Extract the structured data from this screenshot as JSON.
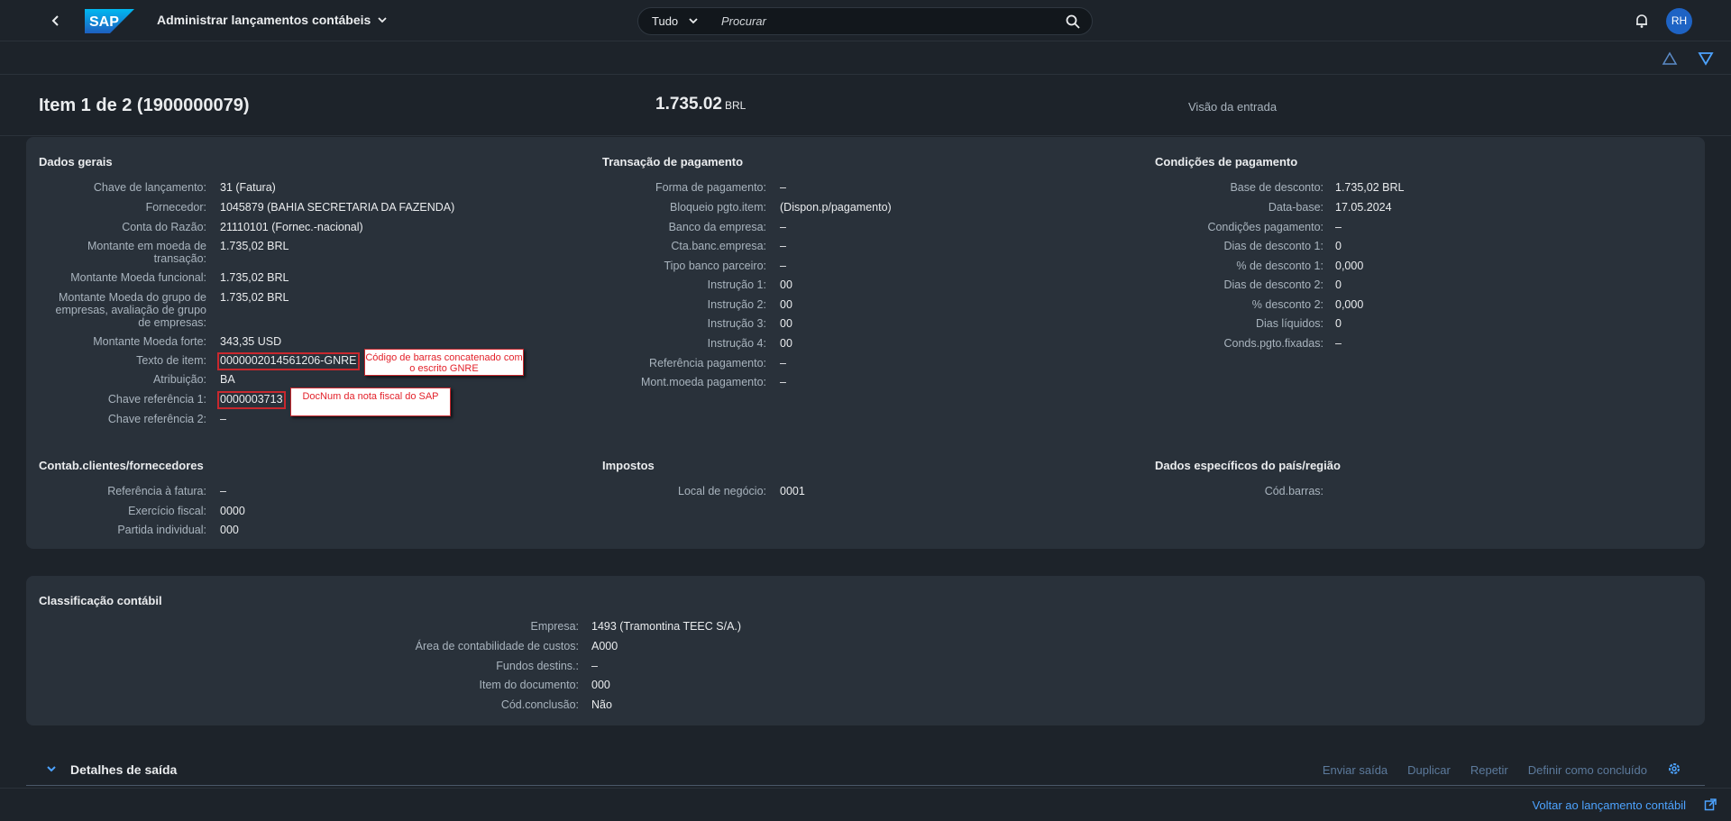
{
  "shell": {
    "logo_text": "SAP",
    "app_title": "Administrar lançamentos contábeis",
    "search_scope": "Tudo",
    "search_placeholder": "Procurar",
    "avatar_initials": "RH"
  },
  "header": {
    "title": "Item 1 de 2 (1900000079)",
    "amount": "1.735.02",
    "currency": "BRL",
    "view_link": "Visão da entrada"
  },
  "dados_gerais": {
    "title": "Dados gerais",
    "rows": [
      {
        "label": "Chave de lançamento:",
        "value": "31 (Fatura)"
      },
      {
        "label": "Fornecedor:",
        "value": "1045879 (BAHIA SECRETARIA DA FAZENDA)"
      },
      {
        "label": "Conta do Razão:",
        "value": "21110101 (Fornec.-nacional)"
      },
      {
        "label": "Montante em moeda de transação:",
        "value": "1.735,02  BRL"
      },
      {
        "label": "Montante Moeda funcional:",
        "value": "1.735,02  BRL"
      },
      {
        "label": "Montante Moeda do grupo de empresas, avaliação de grupo de empresas:",
        "value": "1.735,02  BRL"
      },
      {
        "label": "Montante Moeda forte:",
        "value": "343,35  USD"
      },
      {
        "label": "Texto de item:",
        "value": "0000002014561206-GNRE"
      },
      {
        "label": "Atribuição:",
        "value": "BA"
      },
      {
        "label": "Chave referência 1:",
        "value": "0000003713"
      },
      {
        "label": "Chave referência 2:",
        "value": "–"
      }
    ]
  },
  "transacao_pagamento": {
    "title": "Transação de pagamento",
    "rows": [
      {
        "label": "Forma de pagamento:",
        "value": "–"
      },
      {
        "label": "Bloqueio pgto.item:",
        "value": "(Dispon.p/pagamento)"
      },
      {
        "label": "Banco da empresa:",
        "value": "–"
      },
      {
        "label": "Cta.banc.empresa:",
        "value": "–"
      },
      {
        "label": "Tipo banco parceiro:",
        "value": "–"
      },
      {
        "label": "Instrução 1:",
        "value": "00"
      },
      {
        "label": "Instrução 2:",
        "value": "00"
      },
      {
        "label": "Instrução 3:",
        "value": "00"
      },
      {
        "label": "Instrução 4:",
        "value": "00"
      },
      {
        "label": "Referência pagamento:",
        "value": "–"
      },
      {
        "label": "Mont.moeda pagamento:",
        "value": "–"
      }
    ]
  },
  "condicoes_pagamento": {
    "title": "Condições de pagamento",
    "rows": [
      {
        "label": "Base de desconto:",
        "value": "1.735,02  BRL"
      },
      {
        "label": "Data-base:",
        "value": "17.05.2024"
      },
      {
        "label": "Condições pagamento:",
        "value": "–"
      },
      {
        "label": "Dias de desconto 1:",
        "value": "0"
      },
      {
        "label": "% de desconto 1:",
        "value": "0,000"
      },
      {
        "label": "Dias de desconto 2:",
        "value": "0"
      },
      {
        "label": "% desconto 2:",
        "value": "0,000"
      },
      {
        "label": "Dias líquidos:",
        "value": "0"
      },
      {
        "label": "Conds.pgto.fixadas:",
        "value": "–"
      }
    ]
  },
  "contab": {
    "title": "Contab.clientes/fornecedores",
    "rows": [
      {
        "label": "Referência à fatura:",
        "value": "–"
      },
      {
        "label": "Exercício fiscal:",
        "value": "0000"
      },
      {
        "label": "Partida individual:",
        "value": "000"
      }
    ]
  },
  "impostos": {
    "title": "Impostos",
    "rows": [
      {
        "label": "Local de negócio:",
        "value": "0001"
      }
    ]
  },
  "pais": {
    "title": "Dados específicos do país/região",
    "rows": [
      {
        "label": "Cód.barras:",
        "value": ""
      }
    ]
  },
  "classificacao": {
    "title": "Classificação contábil",
    "rows": [
      {
        "label": "Empresa:",
        "value": "1493 (Tramontina TEEC S/A.)"
      },
      {
        "label": "Área de contabilidade de custos:",
        "value": "A000"
      },
      {
        "label": "Fundos destins.:",
        "value": "–"
      },
      {
        "label": "Item do documento:",
        "value": "000"
      },
      {
        "label": "Cód.conclusão:",
        "value": "Não"
      }
    ]
  },
  "callouts": {
    "barcode": "Código de barras concatenado com o escrito GNRE",
    "docnum": "DocNum da nota fiscal do SAP"
  },
  "details": {
    "title": "Detalhes de saída",
    "actions": [
      "Enviar saída",
      "Duplicar",
      "Repetir",
      "Definir como concluído"
    ]
  },
  "footer": {
    "link": "Voltar ao lançamento contábil"
  },
  "colors": {
    "background": "#1d232a",
    "panel": "#29313a",
    "accent": "#4da3ff",
    "highlight": "#c8282e"
  }
}
